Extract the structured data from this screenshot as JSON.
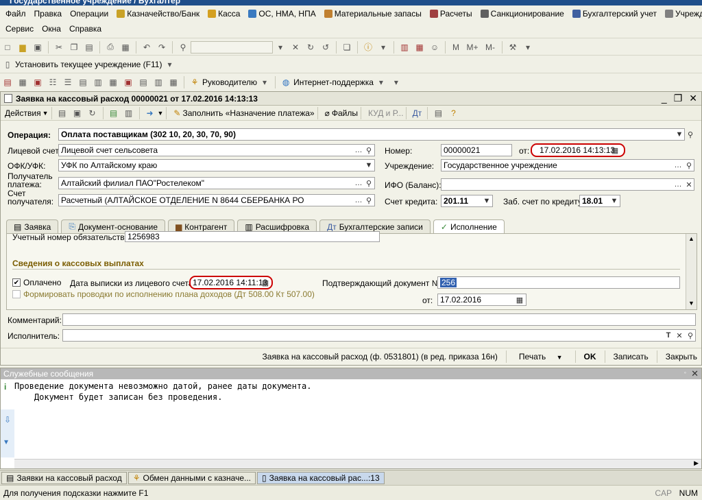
{
  "app": {
    "title": "Государственное учреждение / Бухгалтер"
  },
  "menu": {
    "row1": [
      "Файл",
      "Правка",
      "Операции",
      "Казначейство/Банк",
      "Касса",
      "ОС, НМА, НПА",
      "Материальные запасы",
      "Расчеты",
      "Санкционирование",
      "Бухгалтерский учет",
      "Учреждение"
    ],
    "row2": [
      "Сервис",
      "Окна",
      "Справка"
    ]
  },
  "toolbar2": {
    "set_institution": "Установить текущее учреждение (F11)"
  },
  "toolbar3": {
    "manager": "Руководителю",
    "support": "Интернет-поддержка"
  },
  "document": {
    "title": "Заявка на кассовый расход 00000021 от 17.02.2016 14:13:13",
    "actions": "Действия",
    "fill_purpose": "Заполнить «Назначение платежа»",
    "files": "Файлы",
    "kud": "КУД и Р...",
    "operation_label": "Операция:",
    "operation_value": "Оплата поставщикам (302 10, 20, 30, 70, 90)",
    "account_label": "Лицевой счет:",
    "account_value": "Лицевой счет сельсовета",
    "number_label": "Номер:",
    "number_value": "00000021",
    "from_label": "от:",
    "from_value": "17.02.2016 14:13:13",
    "ofk_label": "ОФК/УФК:",
    "ofk_value": "УФК по Алтайскому краю",
    "institution_label": "Учреждение:",
    "institution_value": "Государственное учреждение",
    "payee_label_1": "Получатель",
    "payee_label_2": "платежа:",
    "payee_value": "Алтайский филиал ПАО\"Ростелеком\"",
    "ifo_label": "ИФО (Баланс):",
    "ifo_value": "",
    "payee_acc_label_1": "Счет",
    "payee_acc_label_2": "получателя:",
    "payee_acc_value": "Расчетный (АЛТАЙСКОЕ ОТДЕЛЕНИЕ N 8644 СБЕРБАНКА РО",
    "credit_label": "Счет кредита:",
    "credit_value": "201.11",
    "offbal_label": "Заб. счет по кредиту:",
    "offbal_value": "18.01",
    "tabs": [
      "Заявка",
      "Документ-основание",
      "Контрагент",
      "Расшифровка",
      "Бухгалтерские записи",
      "Исполнение"
    ],
    "obligation_label": "Учетный номер обязательства:",
    "obligation_value": "1256983",
    "section_title": "Сведения о кассовых выплатах",
    "paid_label": "Оплачено",
    "stmt_date_label": "Дата выписки из лицевого счета:",
    "stmt_date_value": "17.02.2016 14:11:13",
    "confirm_doc_label": "Подтверждающий документ №",
    "confirm_doc_value": "256",
    "income_plan_label": "Формировать проводки по исполнению плана доходов (Дт 508.00 Кт 507.00)",
    "confirm_from_label": "от:",
    "confirm_from_value": "17.02.2016",
    "comment_label": "Комментарий:",
    "comment_value": "",
    "executor_label": "Исполнитель:",
    "executor_value": "",
    "form_link": "Заявка на кассовый расход (ф. 0531801) (в ред. приказа 16н)",
    "print": "Печать",
    "ok": "OK",
    "save": "Записать",
    "close": "Закрыть"
  },
  "messages": {
    "title": "Служебные сообщения",
    "text": "Проведение документа невозможно датой, ранее даты документа.\n    Документ будет записан без проведения."
  },
  "taskbar": [
    "Заявки на кассовый расход",
    "Обмен данными с казначе...",
    "Заявка на кассовый рас...:13"
  ],
  "statusbar": {
    "hint": "Для получения подсказки нажмите F1",
    "cap": "CAP",
    "num": "NUM"
  },
  "colors": {
    "title_bg": "#1f4e8a",
    "highlight": "#cc0000",
    "section": "#7a5c00"
  }
}
